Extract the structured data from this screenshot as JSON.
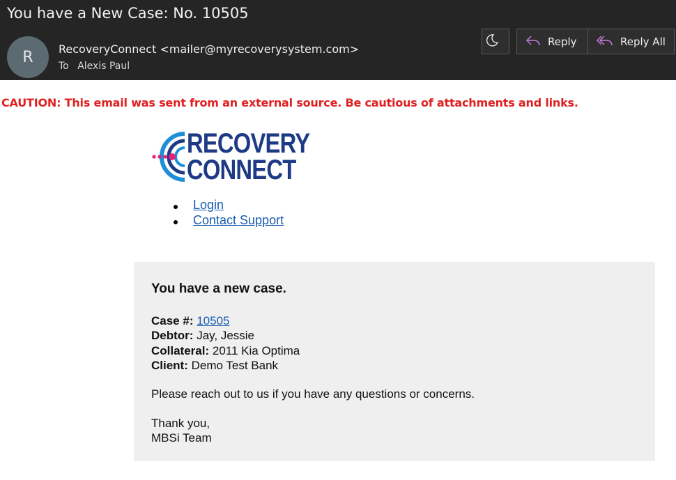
{
  "email": {
    "subject": "You have a New Case: No. 10505",
    "avatar_initial": "R",
    "sender": "RecoveryConnect <mailer@myrecoverysystem.com>",
    "to_label": "To",
    "to_name": "Alexis Paul"
  },
  "toolbar": {
    "moon_icon": "moon-icon",
    "reply_label": "Reply",
    "reply_all_label": "Reply All"
  },
  "caution": "CAUTION: This email was sent from an external source. Be cautious of attachments and links.",
  "logo": {
    "line1": "RECOVERY",
    "line2": "CONNECT",
    "colors": {
      "navy": "#1d3a86",
      "blue": "#1e8fd6",
      "pink": "#e6207a"
    }
  },
  "links": [
    {
      "label": "Login"
    },
    {
      "label": "Contact Support"
    }
  ],
  "card": {
    "title": "You have a new case.",
    "case_label": "Case #:",
    "case_value": "10505",
    "debtor_label": "Debtor:",
    "debtor_value": "Jay, Jessie",
    "collateral_label": "Collateral:",
    "collateral_value": "2011 Kia Optima",
    "client_label": "Client:",
    "client_value": "Demo Test Bank",
    "message": "Please reach out to us if you have any questions or concerns.",
    "signoff": "Thank you,",
    "team": "MBSi Team"
  },
  "colors": {
    "header_bg": "#252525",
    "caution": "#e02020",
    "link": "#1a5db0",
    "card_bg": "#efefef"
  }
}
